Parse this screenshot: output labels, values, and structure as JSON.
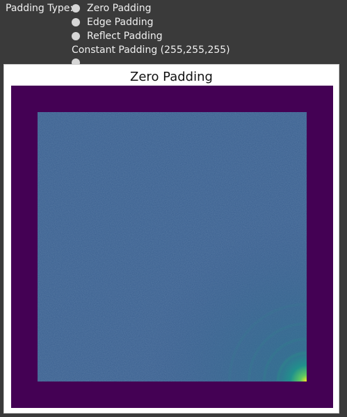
{
  "controls": {
    "label": "Padding Type:",
    "options": [
      "Zero Padding",
      "Edge Padding",
      "Reflect Padding",
      "Constant Padding (255,255,255)"
    ]
  },
  "figure": {
    "title": "Zero Padding"
  },
  "colors": {
    "background": "#3a3a3a",
    "padding_fill": "#440154",
    "image_base": "#3a5f8f",
    "hotspot": "#fde725"
  }
}
